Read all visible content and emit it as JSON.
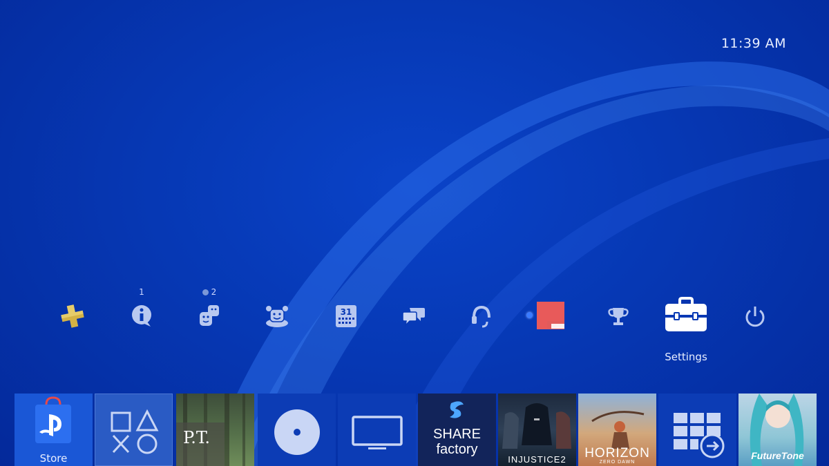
{
  "clock": {
    "time": "11:39 AM"
  },
  "function_bar": {
    "items": [
      {
        "name": "playstation-plus",
        "icon": "ps-plus-icon"
      },
      {
        "name": "notifications",
        "icon": "info-bubble-icon",
        "badge": "1"
      },
      {
        "name": "friends",
        "icon": "friends-icon",
        "badge": "2"
      },
      {
        "name": "party",
        "icon": "party-icon"
      },
      {
        "name": "events",
        "icon": "calendar-icon",
        "calendar_day": "31"
      },
      {
        "name": "messages",
        "icon": "messages-icon"
      },
      {
        "name": "party-voice",
        "icon": "headset-icon"
      },
      {
        "name": "profile",
        "icon": "avatar"
      },
      {
        "name": "trophies",
        "icon": "trophy-icon"
      },
      {
        "name": "settings",
        "icon": "toolbox-icon",
        "label": "Settings",
        "selected": true
      },
      {
        "name": "power",
        "icon": "power-icon"
      }
    ]
  },
  "content_row": {
    "tiles": [
      {
        "name": "store",
        "label": "Store"
      },
      {
        "name": "library"
      },
      {
        "name": "pt",
        "text": "P.T."
      },
      {
        "name": "disc"
      },
      {
        "name": "tv-video"
      },
      {
        "name": "share-factory",
        "text_line1": "SHARE",
        "text_line2": "factory"
      },
      {
        "name": "injustice-2",
        "text": "INJUSTICE2"
      },
      {
        "name": "horizon",
        "text": "HORIZON",
        "subtext": "ZERO DAWN"
      },
      {
        "name": "apps"
      },
      {
        "name": "miku",
        "text": "FutureTone"
      }
    ]
  },
  "colors": {
    "background": "#0638b4",
    "accent": "#1a57d6",
    "ps_plus_gold": "#d4b245"
  }
}
